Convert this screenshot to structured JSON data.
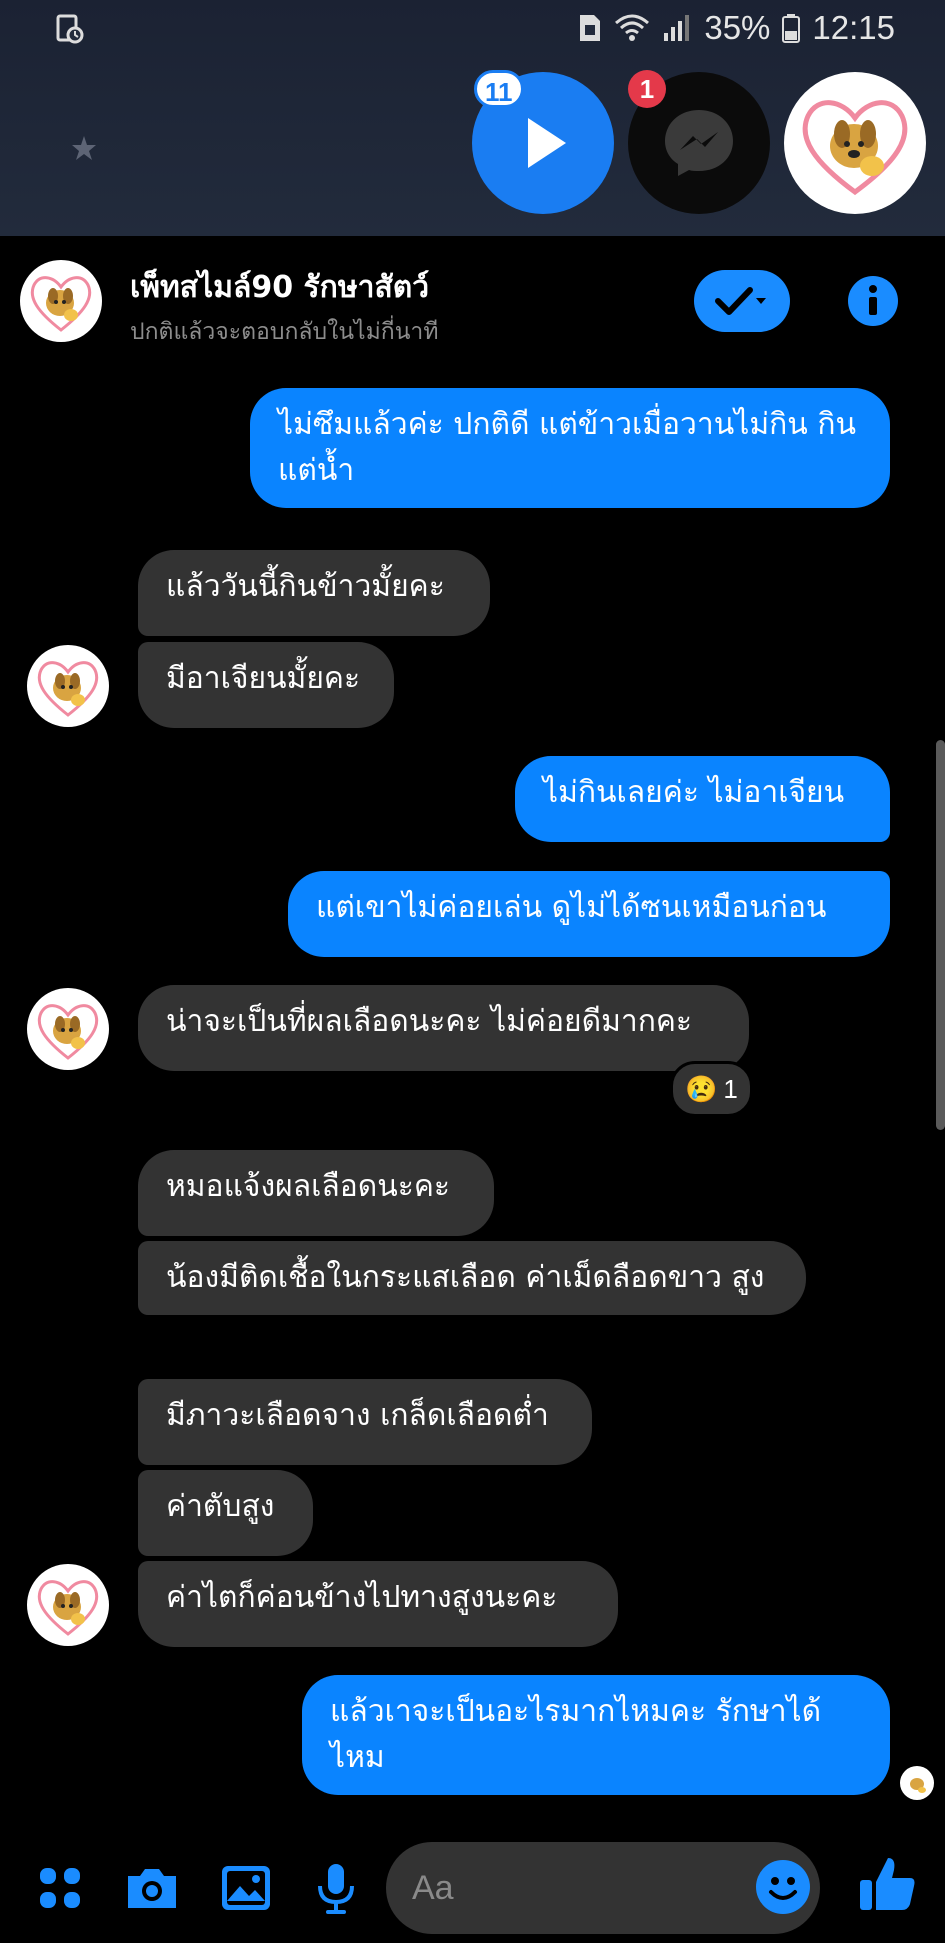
{
  "status_bar": {
    "battery": "35%",
    "time": "12:15"
  },
  "chat_heads": {
    "play_count": "11",
    "messenger_count": "1"
  },
  "header": {
    "name": "เพ็ทสไมล์90 รักษาสัตว์",
    "status": "ปกติแล้วจะตอบกลับในไม่กี่นาที"
  },
  "messages": [
    {
      "dir": "out",
      "text": "ไม่ซึมแล้วค่ะ ปกติดี แต่ข้าวเมื่อวานไม่กิน กินแต่น้ำ"
    },
    {
      "dir": "in",
      "text": "แล้ววันนี้กินข้าวมั้ยคะ"
    },
    {
      "dir": "in",
      "text": "มีอาเจียนมั้ยคะ"
    },
    {
      "dir": "out",
      "text": "ไม่กินเลยค่ะ ไม่อาเจียน"
    },
    {
      "dir": "out",
      "text": "แต่เขาไม่ค่อยเล่น ดูไม่ได้ซนเหมือนก่อน"
    },
    {
      "dir": "in",
      "text": "น่าจะเป็นที่ผลเลือดนะคะ ไม่ค่อยดีมากคะ"
    },
    {
      "dir": "in",
      "text": "หมอแจ้งผลเลือดนะคะ"
    },
    {
      "dir": "in",
      "text": "น้องมีติดเชื้อในกระแสเลือด ค่าเม็ดลือดขาว สูง"
    },
    {
      "dir": "in",
      "text": "มีภาวะเลือดจาง เกล็ดเลือดต่ำ"
    },
    {
      "dir": "in",
      "text": "ค่าตับสูง"
    },
    {
      "dir": "in",
      "text": "ค่าไตก็ค่อนข้างไปทางสูงนะคะ"
    },
    {
      "dir": "out",
      "text": "แล้วเาจะเป็นอะไรมากไหมคะ รักษาได้ไหม"
    }
  ],
  "reaction": {
    "emoji": "😢",
    "count": "1"
  },
  "composer": {
    "placeholder": "Aa"
  },
  "colors": {
    "accent": "#0a84ff",
    "incoming_bubble": "#333333",
    "background": "#000000",
    "badge_red": "#e4394a"
  },
  "icons": [
    "menu-dots-icon",
    "camera-icon",
    "gallery-icon",
    "microphone-icon",
    "emoji-icon",
    "thumbs-up-icon",
    "info-icon",
    "check-dropdown-icon",
    "play-icon",
    "messenger-icon",
    "wifi-icon",
    "signal-icon",
    "battery-icon",
    "screen-recorder-icon",
    "star-icon"
  ]
}
